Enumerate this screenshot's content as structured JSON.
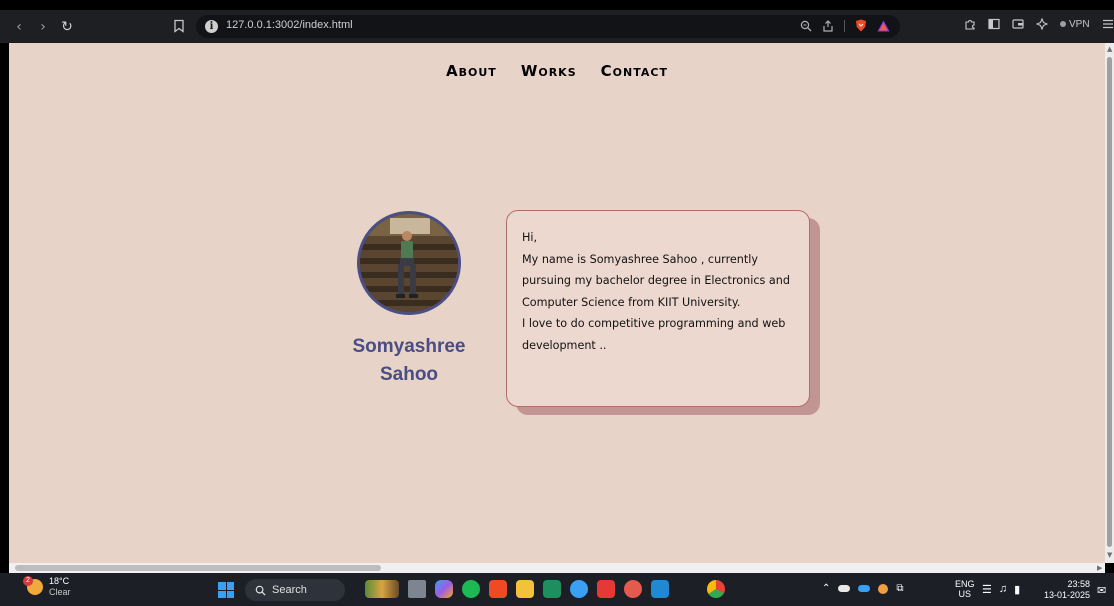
{
  "browser": {
    "url": "127.0.0.1:3002/index.html",
    "vpn_label": "VPN"
  },
  "page": {
    "nav": [
      {
        "label": "About"
      },
      {
        "label": "Works"
      },
      {
        "label": "Contact"
      }
    ],
    "profile": {
      "name_line1": "Somyashree",
      "name_line2": "Sahoo"
    },
    "bio": {
      "greeting": "Hi,",
      "para1": "My name is Somyashree Sahoo , currently pursuing my bachelor degree in Electronics and Computer Science from KIIT University.",
      "para2": "I love to do competitive programming and web development .."
    },
    "colors": {
      "background": "#e8d3c9",
      "name": "#4a4d85",
      "card_border": "#b36c6c",
      "card_shadow": "#c09594"
    }
  },
  "taskbar": {
    "weather_temp": "18°C",
    "weather_cond": "Clear",
    "weather_badge": "2",
    "search_label": "Search",
    "lang_top": "ENG",
    "lang_bottom": "US",
    "time": "23:58",
    "date": "13-01-2025",
    "icons": [
      "windows-icon",
      "search-icon",
      "widgets-icon",
      "task-view-icon",
      "copilot-icon",
      "spotify-icon",
      "brave-icon",
      "file-explorer-icon",
      "classroom-icon",
      "app-icon",
      "youtube-icon",
      "app-icon",
      "vscode-icon",
      "chrome-icon"
    ]
  }
}
